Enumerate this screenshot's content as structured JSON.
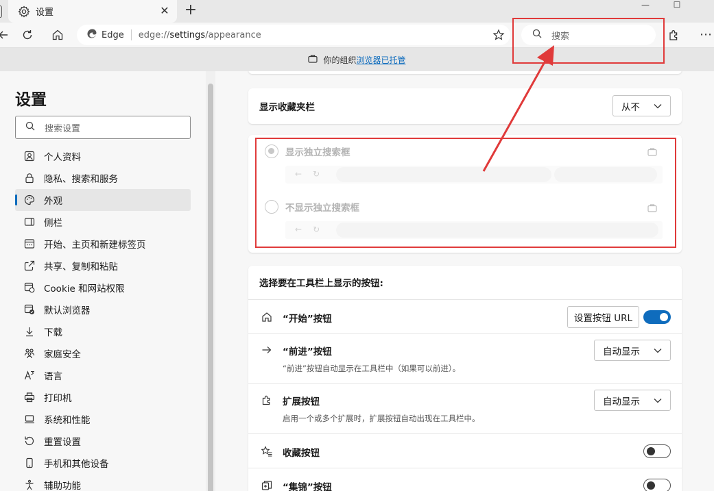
{
  "tab": {
    "title": "设置",
    "close": "✕",
    "new_tab": "+"
  },
  "window": {
    "minimize": "—",
    "maximize": "☐"
  },
  "address": {
    "browser_label": "Edge",
    "url_scheme": "edge://",
    "url_host": "settings",
    "url_path": "/appearance"
  },
  "toolbar_search": {
    "placeholder": "搜索"
  },
  "managed_bar": {
    "prefix": "你的组织",
    "link": "浏览器已托管"
  },
  "nav": {
    "title": "设置",
    "search_placeholder": "搜索设置",
    "items": [
      {
        "label": "个人资料",
        "icon": "profile-icon"
      },
      {
        "label": "隐私、搜索和服务",
        "icon": "lock-icon"
      },
      {
        "label": "外观",
        "icon": "palette-icon",
        "active": true
      },
      {
        "label": "侧栏",
        "icon": "sidebar-icon"
      },
      {
        "label": "开始、主页和新建标签页",
        "icon": "newtab-icon"
      },
      {
        "label": "共享、复制和粘贴",
        "icon": "share-icon"
      },
      {
        "label": "Cookie 和网站权限",
        "icon": "cookie-icon"
      },
      {
        "label": "默认浏览器",
        "icon": "default-browser-icon"
      },
      {
        "label": "下载",
        "icon": "download-icon"
      },
      {
        "label": "家庭安全",
        "icon": "family-icon"
      },
      {
        "label": "语言",
        "icon": "language-icon"
      },
      {
        "label": "打印机",
        "icon": "printer-icon"
      },
      {
        "label": "系统和性能",
        "icon": "laptop-icon"
      },
      {
        "label": "重置设置",
        "icon": "reset-icon"
      },
      {
        "label": "手机和其他设备",
        "icon": "phone-icon"
      },
      {
        "label": "辅助功能",
        "icon": "accessibility-icon"
      }
    ]
  },
  "favorites_bar": {
    "label": "显示收藏夹栏",
    "value": "从不"
  },
  "search_box_options": [
    {
      "label": "显示独立搜索框",
      "checked": true
    },
    {
      "label": "不显示独立搜索框",
      "checked": false
    }
  ],
  "toolbar_buttons": {
    "heading": "选择要在工具栏上显示的按钮:",
    "home": {
      "label": "“开始”按钮",
      "button": "设置按钮 URL",
      "enabled": true
    },
    "forward": {
      "label": "“前进”按钮",
      "value": "自动显示",
      "desc": "“前进”按钮自动显示在工具栏中（如果可以前进）。"
    },
    "extensions": {
      "label": "扩展按钮",
      "value": "自动显示",
      "desc": "启用一个或多个扩展时，扩展按钮自动出现在工具栏中。"
    },
    "favorites": {
      "label": "收藏按钮",
      "enabled": false
    },
    "collections": {
      "label": "“集锦”按钮",
      "enabled": false
    }
  },
  "colors": {
    "accent": "#0f6cbd",
    "annotation": "#e03a3a"
  }
}
